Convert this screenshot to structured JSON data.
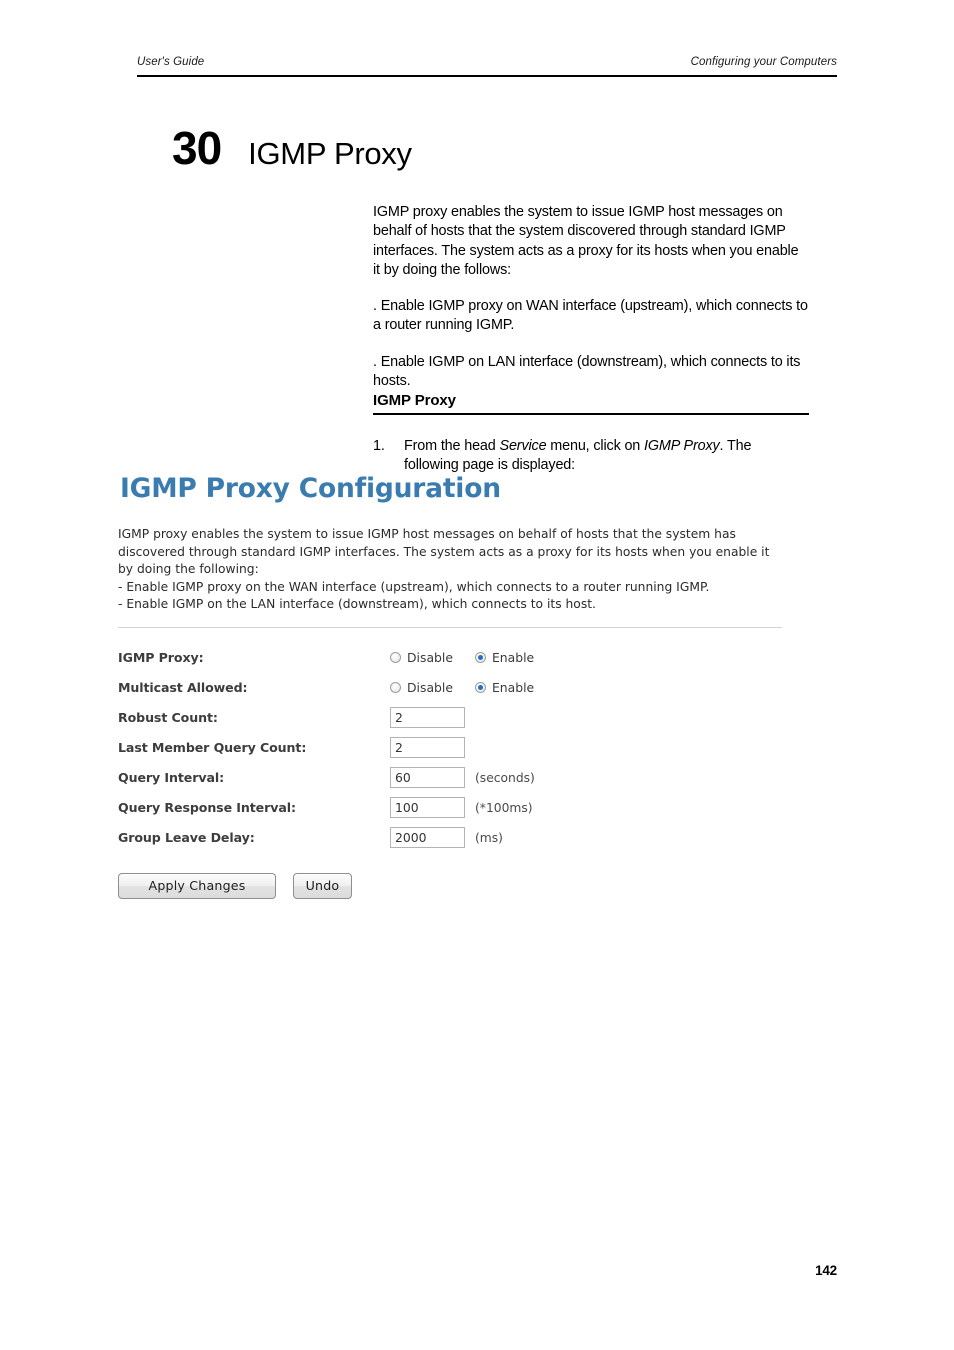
{
  "header": {
    "left": "User's Guide",
    "right": "Configuring your Computers"
  },
  "chapter": {
    "number": "30",
    "title": "IGMP Proxy"
  },
  "intro": {
    "paragraph1": "IGMP proxy enables the system to issue IGMP host messages on behalf of hosts that the system discovered through standard IGMP interfaces. The system acts as a proxy for its hosts when you enable it by doing the follows:",
    "paragraph2": ". Enable IGMP proxy on WAN interface (upstream), which connects to a router running IGMP.",
    "paragraph3": ". Enable IGMP on LAN interface (downstream), which connects to its hosts."
  },
  "section": {
    "heading": "IGMP Proxy"
  },
  "step": {
    "number": "1.",
    "text_part1": "From the head ",
    "text_italic1": "Service",
    "text_part2": "  menu, click on ",
    "text_italic2": "IGMP Proxy",
    "text_part3": ". The following page is displayed:"
  },
  "screenshot": {
    "title": "IGMP Proxy Configuration",
    "description_line1": "IGMP proxy enables the system to issue IGMP host messages on behalf of hosts that the system has discovered through standard IGMP interfaces. The system acts as a proxy for its hosts when you enable it by doing the following:",
    "description_line2": "- Enable IGMP proxy on the WAN interface (upstream), which connects to a router running IGMP.",
    "description_line3": "- Enable IGMP on the LAN interface (downstream), which connects to its host.",
    "form": {
      "igmp_proxy": {
        "label": "IGMP Proxy:",
        "option_disable": "Disable",
        "option_enable": "Enable",
        "selected": "Enable"
      },
      "multicast_allowed": {
        "label": "Multicast Allowed:",
        "option_disable": "Disable",
        "option_enable": "Enable",
        "selected": "Enable"
      },
      "robust_count": {
        "label": "Robust Count:",
        "value": "2",
        "unit": ""
      },
      "last_member_query_count": {
        "label": "Last Member Query Count:",
        "value": "2",
        "unit": ""
      },
      "query_interval": {
        "label": "Query Interval:",
        "value": "60",
        "unit": "(seconds)"
      },
      "query_response_interval": {
        "label": "Query Response Interval:",
        "value": "100",
        "unit": "(*100ms)"
      },
      "group_leave_delay": {
        "label": "Group Leave Delay:",
        "value": "2000",
        "unit": "(ms)"
      }
    },
    "buttons": {
      "apply": "Apply Changes",
      "undo": "Undo"
    },
    "accent_color": "#3b7cb0",
    "radio_selected_color": "#1f6fc4"
  },
  "footer": {
    "page_number": "142"
  }
}
